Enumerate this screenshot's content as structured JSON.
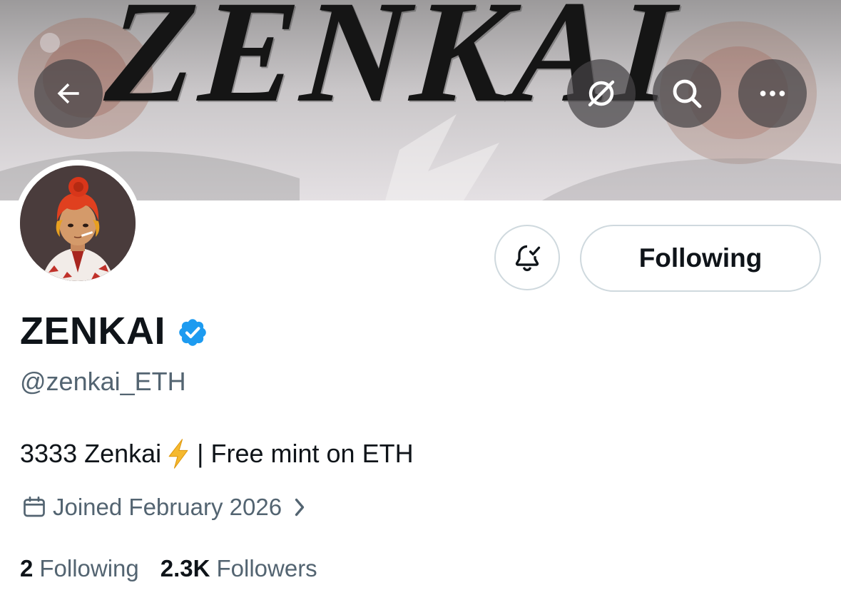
{
  "banner": {
    "title": "ZENKAI"
  },
  "header_buttons": {
    "back_icon": "arrow-left-icon",
    "grok_icon": "grok-icon",
    "search_icon": "search-icon",
    "more_icon": "more-horizontal-icon"
  },
  "actions": {
    "notify_icon": "bell-check-icon",
    "following_label": "Following"
  },
  "profile": {
    "display_name": "ZENKAI",
    "verified": true,
    "handle": "@zenkai_ETH",
    "bio_prefix": "3333 Zenkai",
    "bio_emoji": "⚡",
    "bio_suffix": "| Free mint on ETH",
    "joined": "Joined February 2026"
  },
  "stats": {
    "following_count": "2",
    "following_label": "Following",
    "followers_count": "2.3K",
    "followers_label": "Followers"
  },
  "colors": {
    "text_primary": "#0f1419",
    "text_secondary": "#536471",
    "border": "#cfd9de",
    "verified_blue": "#1d9bf0",
    "bolt_yellow": "#f5b92f"
  }
}
